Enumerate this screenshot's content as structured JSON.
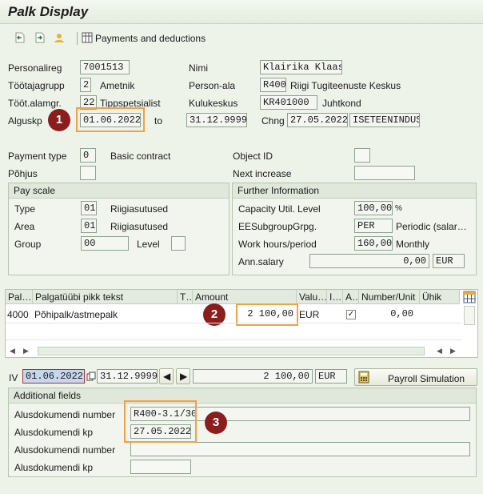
{
  "title": "Palk Display",
  "toolbar": {
    "payments_label": "Payments and deductions"
  },
  "header": {
    "personalireg_label": "Personalireg",
    "personalireg_value": "7001513",
    "nimi_label": "Nimi",
    "nimi_value": "Klairika Klaas",
    "tootajagrupp_label": "Töötajagrupp",
    "tootajagrupp_value": "2",
    "tootajagrupp_text": "Ametnik",
    "personala_label": "Person-ala",
    "personala_value": "R400",
    "personala_text": "Riigi Tugiteenuste Keskus",
    "tootalamgr_label": "Tööt.alamgr.",
    "tootalamgr_value": "22",
    "tootalamgr_text": "Tippspetsialist",
    "kulukeskus_label": "Kulukeskus",
    "kulukeskus_value": "KR401000",
    "kulukeskus_text": "Juhtkond",
    "alguskp_label": "Alguskp",
    "alguskp_value": "01.06.2022",
    "to_label": "to",
    "to_value": "31.12.9999",
    "chng_label": "Chng",
    "chng_date": "27.05.2022",
    "chng_user": "ISETEENINDUS"
  },
  "badges": [
    "1",
    "2",
    "3"
  ],
  "basic": {
    "payment_type_label": "Payment type",
    "payment_type_value": "0",
    "payment_type_text": "Basic contract",
    "object_id_label": "Object ID",
    "pohjus_label": "Põhjus",
    "next_increase_label": "Next increase"
  },
  "pay_scale": {
    "title": "Pay scale",
    "type_label": "Type",
    "type_value": "01",
    "type_text": "Riigiasutused",
    "area_label": "Area",
    "area_value": "01",
    "area_text": "Riigiasutused",
    "group_label": "Group",
    "group_value": "00",
    "level_label": "Level"
  },
  "further": {
    "title": "Further Information",
    "capacity_label": "Capacity Util. Level",
    "capacity_value": "100,00",
    "capacity_unit": "%",
    "eesub_label": "EESubgroupGrpg.",
    "eesub_value": "PER",
    "eesub_text": "Periodic (salar…",
    "work_hours_label": "Work hours/period",
    "work_hours_value": "160,00",
    "work_hours_unit": "Monthly",
    "ann_salary_label": "Ann.salary",
    "ann_salary_value": "0,00",
    "ann_salary_currency": "EUR"
  },
  "table": {
    "headers": [
      "Pal…",
      "Palgatüübi pikk tekst",
      "T…",
      "Amount",
      "Valu…",
      "I…",
      "A…",
      "Number/Unit",
      "Ühik"
    ],
    "rows": [
      {
        "wage_type": "4000",
        "text": "Põhipalk/astmepalk",
        "amount": "2 100,00",
        "currency": "EUR",
        "checked": true,
        "number": "0,00"
      }
    ]
  },
  "summary": {
    "iv_label": "IV",
    "from": "01.06.2022",
    "to": "31.12.9999",
    "total": "2 100,00",
    "currency": "EUR",
    "simulation_label": "Payroll Simulation"
  },
  "additional": {
    "title": "Additional fields",
    "items": [
      {
        "label": "Alusdokumendi number",
        "value": "R400-3.1/30"
      },
      {
        "label": "Alusdokumendi kp",
        "value": "27.05.2022"
      },
      {
        "label": "Alusdokumendi number",
        "value": ""
      },
      {
        "label": "Alusdokumendi kp",
        "value": ""
      }
    ]
  }
}
